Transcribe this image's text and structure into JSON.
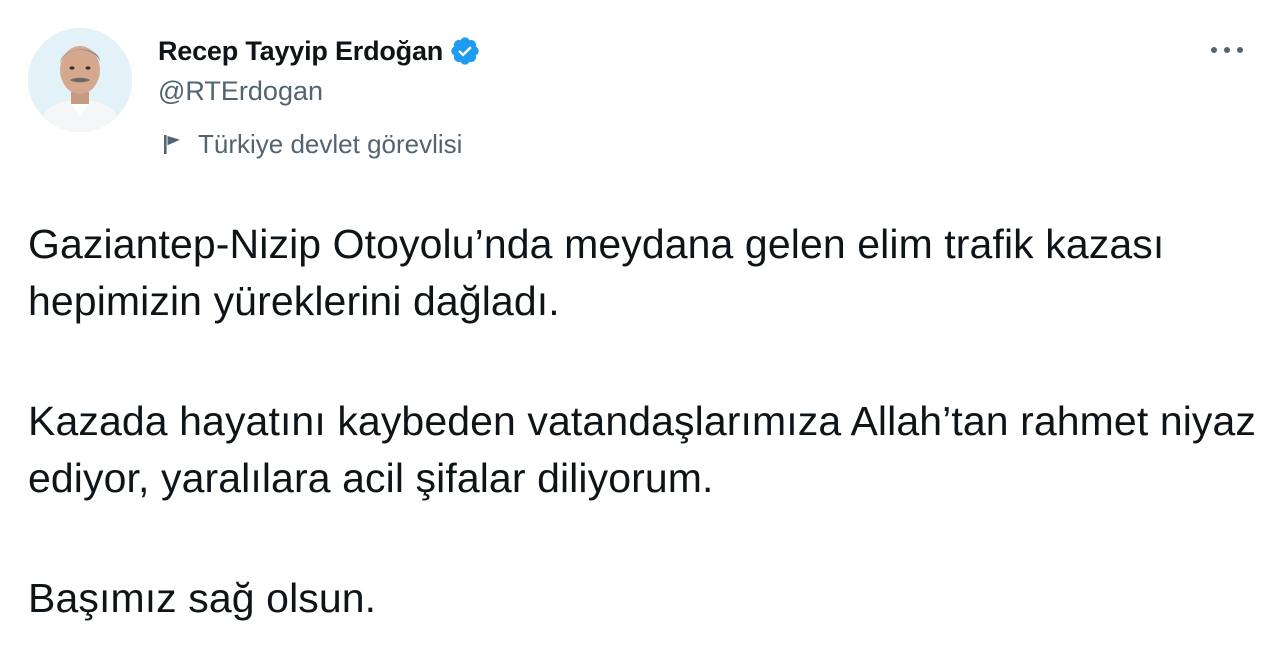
{
  "author": {
    "display_name": "Recep Tayyip Erdoğan",
    "handle": "@RTErdogan",
    "verified": true,
    "account_label": "Türkiye devlet görevlisi",
    "avatar_icon": "avatar-photo",
    "label_icon": "flag-icon",
    "verified_icon": "verified-badge-icon"
  },
  "actions": {
    "more_icon": "more-options-icon"
  },
  "tweet": {
    "paragraphs": [
      "Gaziantep-Nizip Otoyolu’nda meydana gelen elim trafik kazası hepimizin yüreklerini dağladı.",
      "Kazada hayatını kaybeden vatandaşlarımıza Allah’tan rahmet niyaz ediyor, yaralılara acil şifalar diliyorum.",
      "Başımız sağ olsun."
    ]
  },
  "colors": {
    "text_primary": "#0f1419",
    "text_secondary": "#536471",
    "verified_blue": "#1d9bf0",
    "background": "#ffffff"
  }
}
